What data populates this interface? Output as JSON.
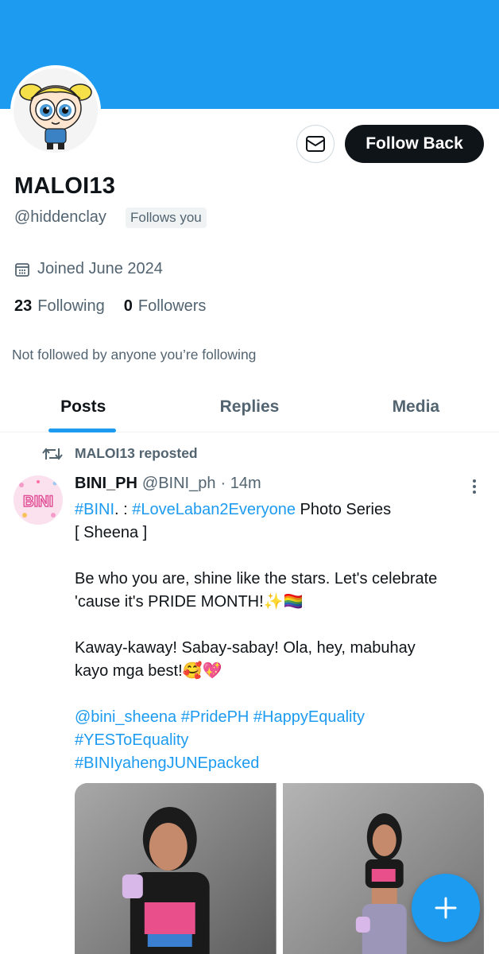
{
  "profile": {
    "display_name": "MALOI13",
    "handle": "@hiddenclay",
    "follows_you_badge": "Follows you",
    "joined": "Joined June 2024",
    "following_count": "23",
    "following_label": "Following",
    "followers_count": "0",
    "followers_label": "Followers",
    "not_followed_note": "Not followed by anyone you’re following",
    "follow_back_label": "Follow Back"
  },
  "tabs": [
    {
      "label": "Posts",
      "active": true
    },
    {
      "label": "Replies",
      "active": false
    },
    {
      "label": "Media",
      "active": false
    }
  ],
  "post": {
    "repost_label": "MALOI13 reposted",
    "author": "BINI_PH",
    "handle": "@BINI_ph",
    "time": "· 14m",
    "avatar_text": "BINI",
    "line1_tag1": "#BINI",
    "line1_sep": ". : ",
    "line1_tag2": "#LoveLaban2Everyone",
    "line1_rest": " Photo Series",
    "line2": "[ Sheena ]",
    "line3": "Be who you are, shine like the stars. Let's celebrate",
    "line4": "'cause it's PRIDE MONTH!✨🏳️‍🌈",
    "line5": "Kaway-kaway! Sabay-sabay! Ola, hey, mabuhay",
    "line6": "kayo mga best!🥰💖",
    "mention": "@bini_sheena",
    "tag_pride": "#PridePH",
    "tag_equality": "#HappyEquality",
    "tag_yes": "#YESToEquality",
    "tag_june": "#BINIyahengJUNEpacked"
  },
  "colors": {
    "accent": "#1d9bf0",
    "text": "#0f1419",
    "muted": "#536471",
    "button_dark": "#0f1419"
  },
  "icons": {
    "mail": "mail-icon",
    "calendar": "calendar-icon",
    "repost": "repost-icon",
    "more": "more-vertical-icon",
    "compose": "plus-icon"
  }
}
